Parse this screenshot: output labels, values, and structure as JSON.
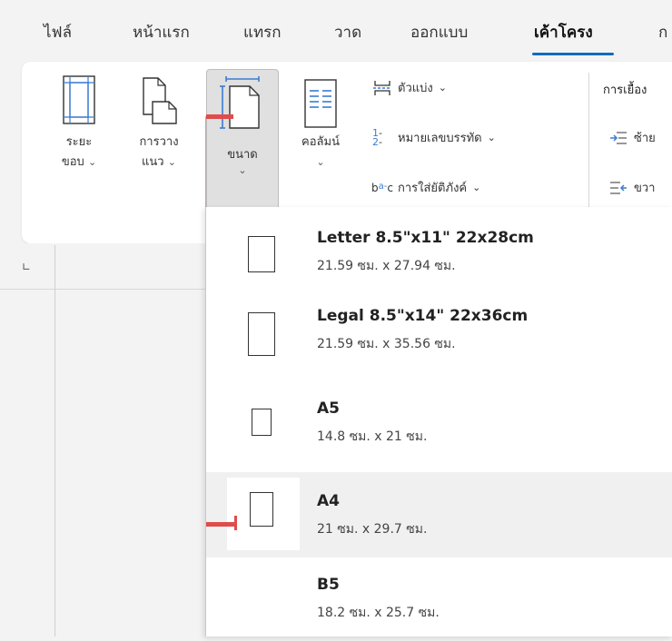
{
  "tabs": [
    {
      "label": "ไฟล์"
    },
    {
      "label": "หน้าแรก"
    },
    {
      "label": "แทรก"
    },
    {
      "label": "วาด"
    },
    {
      "label": "ออกแบบ"
    },
    {
      "label": "เค้าโครง"
    },
    {
      "label": "ก"
    }
  ],
  "active_tab": "เค้าโครง",
  "ribbon": {
    "margins": {
      "line1": "ระยะ",
      "line2": "ขอบ"
    },
    "orientation": {
      "line1": "การวาง",
      "line2": "แนว"
    },
    "size": {
      "line1": "ขนาด"
    },
    "columns": {
      "line1": "คอลัมน์"
    },
    "breaks": "ตัวแบ่ง",
    "line_numbers": "หมายเลขบรรทัด",
    "hyphenation": "การใส่ยัติภังค์",
    "indent_title": "การเยื้อง",
    "indent_left": "ซ้าย",
    "indent_right": "ขวา"
  },
  "paper_sizes": [
    {
      "title": "Letter 8.5\"x11\" 22x28cm",
      "dims": "21.59 ซม. x 27.94 ซม."
    },
    {
      "title": "Legal 8.5\"x14\" 22x36cm",
      "dims": "21.59 ซม. x 35.56 ซม."
    },
    {
      "title": "A5",
      "dims": "14.8 ซม. x 21 ซม."
    },
    {
      "title": "A4",
      "dims": "21 ซม. x 29.7 ซม."
    },
    {
      "title": "B5",
      "dims": "18.2 ซม. x 25.7 ซม."
    }
  ],
  "selected_size": "A4",
  "colors": {
    "accent": "#0f6cbd",
    "highlight": "#e04b4b"
  }
}
